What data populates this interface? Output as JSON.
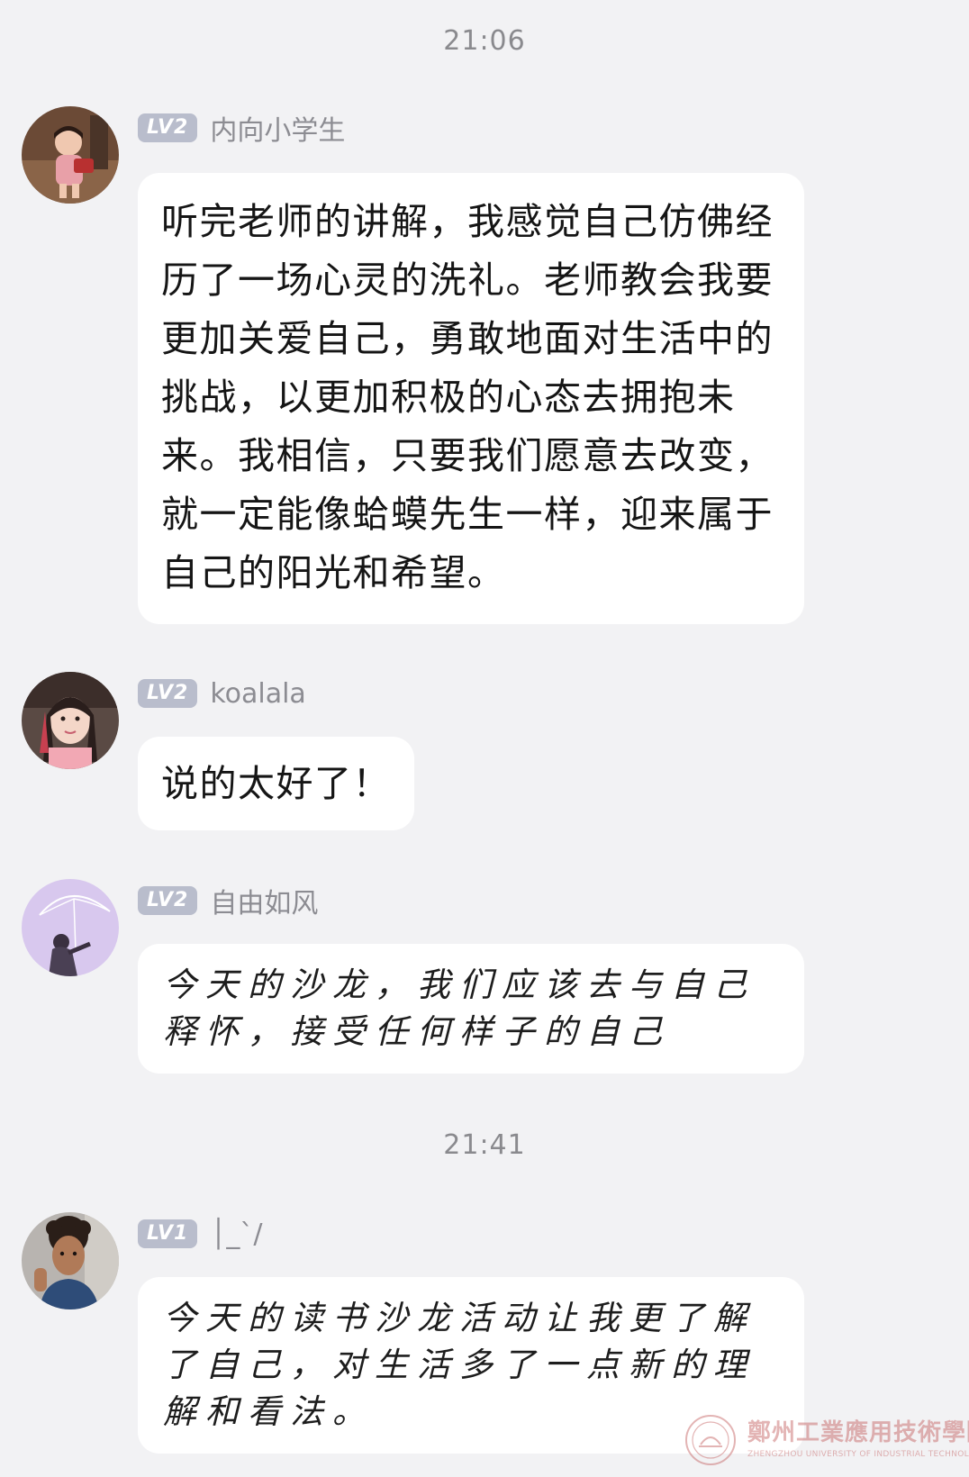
{
  "timestamps": [
    "21:06",
    "21:41"
  ],
  "messages": [
    {
      "level": "LV2",
      "nickname": "内向小学生",
      "avatar": "girl-photo-avatar",
      "text": "听完老师的讲解，我感觉自己仿佛经历了一场心灵的洗礼。老师教会我要更加关爱自己，勇敢地面对生活中的挑战，以更加积极的心态去拥抱未来。我相信，只要我们愿意去改变，就一定能像蛤蟆先生一样，迎来属于自己的阳光和希望。"
    },
    {
      "level": "LV2",
      "nickname": "koalala",
      "avatar": "woman-selfie-avatar",
      "text": "说的太好了！"
    },
    {
      "level": "LV2",
      "nickname": "自由如风",
      "avatar": "umbrella-sketch-avatar",
      "text": "今天的沙龙，我们应该去与自己释怀，接受任何样子的自己"
    },
    {
      "level": "LV1",
      "nickname": "│_`/",
      "avatar": "man-photo-avatar",
      "text": "今天的读书沙龙活动让我更了解了自己，对生活多了一点新的理解和看法。"
    }
  ],
  "watermark": {
    "name": "鄭州工業應用技術學院",
    "subtitle": "ZHENGZHOU UNIVERSITY OF INDUSTRIAL TECHNOLOGY",
    "icon": "university-seal-icon"
  },
  "colors": {
    "background": "#f2f2f4",
    "bubble": "#ffffff",
    "level_badge": "#b9bdcc",
    "meta_text": "#8c8c92"
  }
}
